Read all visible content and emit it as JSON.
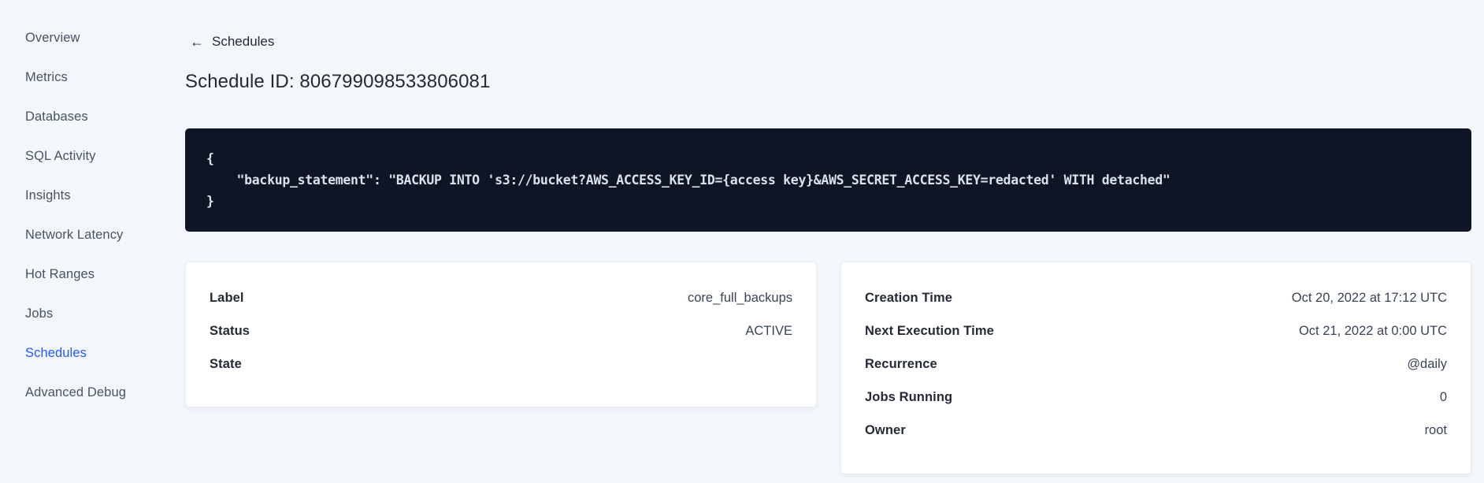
{
  "sidebar": {
    "items": [
      {
        "label": "Overview",
        "active": false
      },
      {
        "label": "Metrics",
        "active": false
      },
      {
        "label": "Databases",
        "active": false
      },
      {
        "label": "SQL Activity",
        "active": false
      },
      {
        "label": "Insights",
        "active": false
      },
      {
        "label": "Network Latency",
        "active": false
      },
      {
        "label": "Hot Ranges",
        "active": false
      },
      {
        "label": "Jobs",
        "active": false
      },
      {
        "label": "Schedules",
        "active": true
      },
      {
        "label": "Advanced Debug",
        "active": false
      }
    ]
  },
  "header": {
    "back_icon": "←",
    "back_label": "Schedules",
    "title": "Schedule ID: 806799098533806081"
  },
  "code_block": {
    "lines": [
      {
        "text": "{"
      },
      {
        "text": "    \"backup_statement\": \"BACKUP INTO 's3://bucket?AWS_ACCESS_KEY_ID={access key}&AWS_SECRET_ACCESS_KEY=redacted' WITH detached\""
      },
      {
        "text": "}"
      }
    ]
  },
  "details_card": {
    "rows": [
      {
        "label": "Label",
        "value": "core_full_backups"
      },
      {
        "label": "Status",
        "value": "ACTIVE"
      },
      {
        "label": "State",
        "value": ""
      }
    ]
  },
  "schedule_card": {
    "rows": [
      {
        "label": "Creation Time",
        "value": "Oct 20, 2022 at 17:12 UTC"
      },
      {
        "label": "Next Execution Time",
        "value": "Oct 21, 2022 at 0:00 UTC"
      },
      {
        "label": "Recurrence",
        "value": "@daily"
      },
      {
        "label": "Jobs Running",
        "value": "0"
      },
      {
        "label": "Owner",
        "value": "root"
      }
    ]
  },
  "colors": {
    "accent_blue": "#2058ff",
    "page_background": "#f3f6fa",
    "code_background": "#0e1524",
    "code_text": "#dbe1ec",
    "text_primary": "#242a35",
    "text_secondary": "#394455",
    "sidebar_text": "#475464",
    "card_border": "#e8edf3"
  }
}
